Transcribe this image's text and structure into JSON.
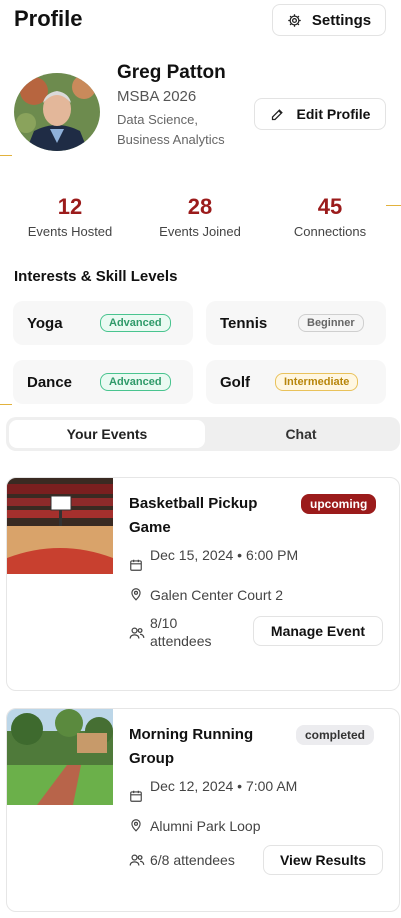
{
  "header": {
    "title": "Profile",
    "settings_label": "Settings"
  },
  "profile": {
    "name": "Greg Patton",
    "program": "MSBA 2026",
    "field": "Data Science, Business Analytics",
    "edit_label": "Edit Profile"
  },
  "stats": [
    {
      "value": "12",
      "label": "Events Hosted"
    },
    {
      "value": "28",
      "label": "Events Joined"
    },
    {
      "value": "45",
      "label": "Connections"
    }
  ],
  "skills_section": {
    "title": "Interests & Skill Levels",
    "items": [
      {
        "name": "Yoga",
        "level": "Advanced"
      },
      {
        "name": "Tennis",
        "level": "Beginner"
      },
      {
        "name": "Dance",
        "level": "Advanced"
      },
      {
        "name": "Golf",
        "level": "Intermediate"
      }
    ]
  },
  "tabs": [
    {
      "label": "Your Events",
      "active": true
    },
    {
      "label": "Chat",
      "active": false
    }
  ],
  "events": [
    {
      "title": "Basketball Pickup Game",
      "status": "upcoming",
      "date": "Dec 15, 2024 • 6:00 PM",
      "location": "Galen Center Court 2",
      "attendees": "8/10 attendees",
      "action": "Manage Event"
    },
    {
      "title": "Morning Running Group",
      "status": "completed",
      "date": "Dec 12, 2024 • 7:00 AM",
      "location": "Alumni Park Loop",
      "attendees": "6/8 attendees",
      "action": "View Results"
    }
  ],
  "colors": {
    "accent": "#9b1b1b",
    "advanced": "#2f9a69",
    "intermediate": "#b8860b",
    "gold_line": "#e2b23d"
  }
}
